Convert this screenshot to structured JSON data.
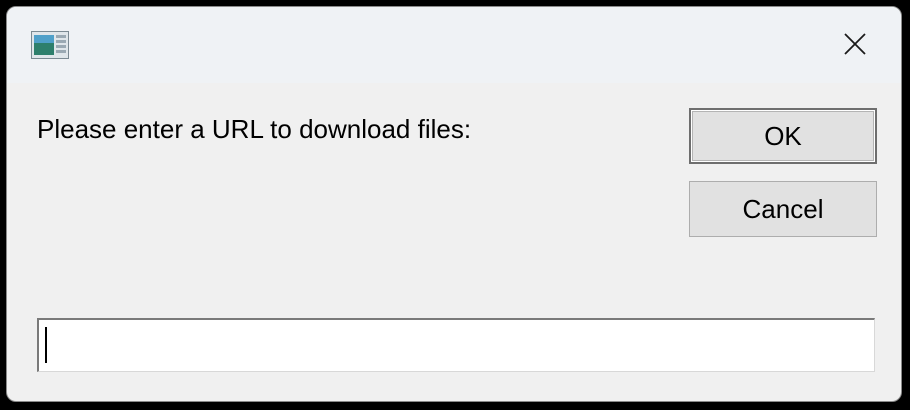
{
  "dialog": {
    "icon": "window-app-icon",
    "close_icon": "close-icon",
    "prompt_text": "Please enter a URL to download files:",
    "ok_label": "OK",
    "cancel_label": "Cancel",
    "url_input_value": ""
  },
  "colors": {
    "window_bg": "#f0f0f0",
    "titlebar_bg": "#eff2f5",
    "button_bg": "#e1e1e1",
    "input_bg": "#ffffff"
  }
}
